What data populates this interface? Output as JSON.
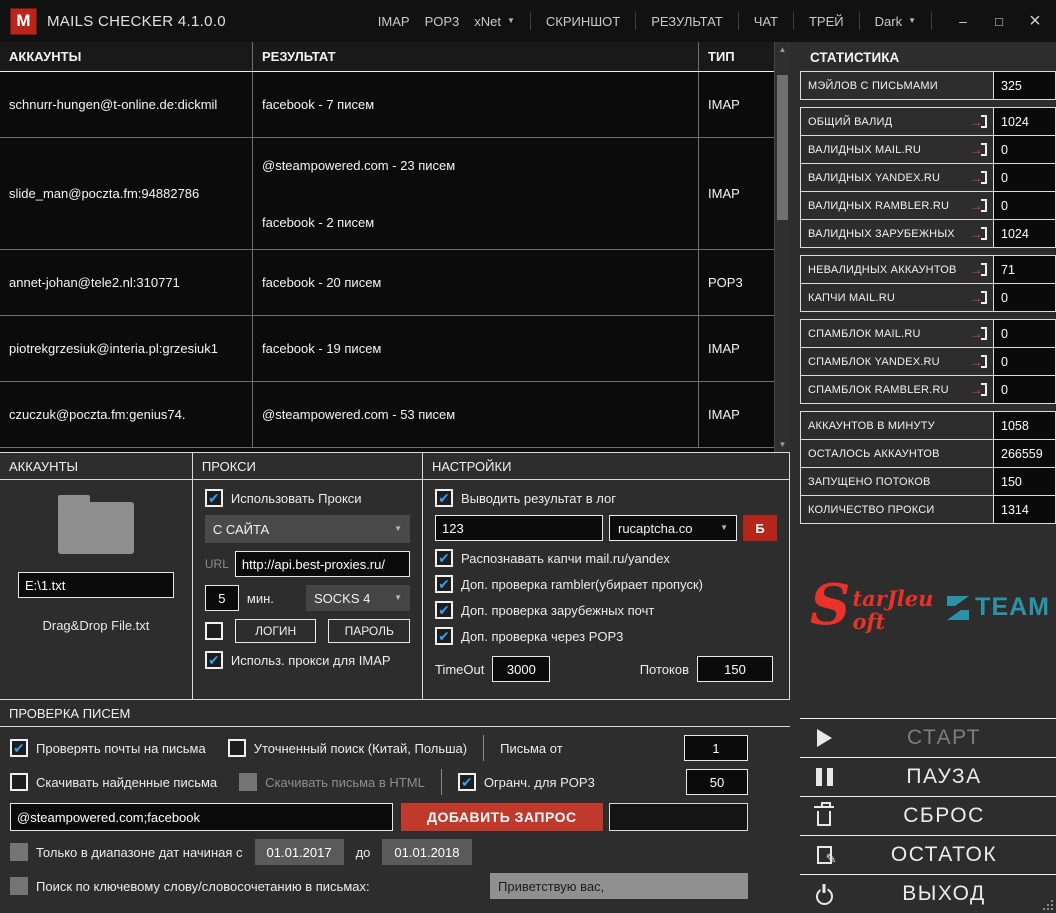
{
  "icons": {
    "check": "✔",
    "caret_down": "▼",
    "scroll_up": "▲",
    "scroll_down": "▼",
    "minimize": "–",
    "maximize": "□",
    "close": "×"
  },
  "colors": {
    "accent_red": "#b8251b",
    "button_red": "#c0392b",
    "check_blue": "#2f9ff2",
    "team_teal": "#2a93a8",
    "starjleu_red": "#e8322a"
  },
  "titlebar": {
    "logo_letter": "M",
    "title": "MAILS CHECKER 4.1.0.0",
    "menu": {
      "imap": "IMAP",
      "pop3": "POP3",
      "xnet": "xNet",
      "screenshot": "СКРИНШОТ",
      "result": "РЕЗУЛЬТАТ",
      "chat": "ЧАТ",
      "tray": "ТРЕЙ",
      "theme": "Dark"
    }
  },
  "results_table": {
    "headers": {
      "accounts": "АККАУНТЫ",
      "result": "РЕЗУЛЬТАТ",
      "type": "ТИП"
    },
    "rows": [
      {
        "account": "schnurr-hungen@t-online.de:dickmil",
        "line1": "facebook - 7 писем",
        "type": "IMAP"
      },
      {
        "account": "slide_man@poczta.fm:94882786",
        "line1": "@steampowered.com - 23 писем",
        "line2": "facebook - 2 писем",
        "type": "IMAP"
      },
      {
        "account": "annet-johan@tele2.nl:310771",
        "line1": "facebook - 20 писем",
        "type": "POP3"
      },
      {
        "account": "piotrekgrzesiuk@interia.pl:grzesiuk1",
        "line1": "facebook - 19 писем",
        "type": "IMAP"
      },
      {
        "account": "czuczuk@poczta.fm:genius74.",
        "line1": "@steampowered.com - 53 писем",
        "type": "IMAP"
      }
    ]
  },
  "stats": {
    "title": "СТАТИСТИКА",
    "rows": [
      {
        "label": "МЭЙЛОВ С ПИСЬМАМИ",
        "value": "325"
      },
      {
        "label": "ОБЩИЙ ВАЛИД",
        "value": "1024"
      },
      {
        "label": "ВАЛИДНЫХ MAIL.RU",
        "value": "0"
      },
      {
        "label": "ВАЛИДНЫХ YANDEX.RU",
        "value": "0"
      },
      {
        "label": "ВАЛИДНЫХ RAMBLER.RU",
        "value": "0"
      },
      {
        "label": "ВАЛИДНЫХ ЗАРУБЕЖНЫХ",
        "value": "1024"
      },
      {
        "label": "НЕВАЛИДНЫХ АККАУНТОВ",
        "value": "71"
      },
      {
        "label": "КАПЧИ MAIL.RU",
        "value": "0"
      },
      {
        "label": "СПАМБЛОК MAIL.RU",
        "value": "0"
      },
      {
        "label": "СПАМБЛОК YANDEX.RU",
        "value": "0"
      },
      {
        "label": "СПАМБЛОК RAMBLER.RU",
        "value": "0"
      },
      {
        "label": "АККАУНТОВ В МИНУТУ",
        "value": "1058"
      },
      {
        "label": "ОСТАЛОСЬ АККАУНТОВ",
        "value": "266559"
      },
      {
        "label": "ЗАПУЩЕНО ПОТОКОВ",
        "value": "150"
      },
      {
        "label": "КОЛИЧЕСТВО ПРОКСИ",
        "value": "1314"
      }
    ]
  },
  "accounts_panel": {
    "title": "АККАУНТЫ",
    "file_path": "E:\\1.txt",
    "hint": "Drag&Drop File.txt"
  },
  "proxy_panel": {
    "title": "ПРОКСИ",
    "use_proxy_label": "Использовать Прокси",
    "source_selected": "С САЙТА",
    "url_label": "URL",
    "url_value": "http://api.best-proxies.ru/",
    "interval_value": "5",
    "interval_unit": "мин.",
    "socks_selected": "SOCKS 4",
    "login_label": "ЛОГИН",
    "password_label": "ПАРОЛЬ",
    "imap_proxy_label": "Использ. прокси для IMAP"
  },
  "settings_panel": {
    "title": "НАСТРОЙКИ",
    "log_label": "Выводить результат в лог",
    "captcha_key_value": "123",
    "captcha_service_selected": "rucaptcha.co",
    "balance_button_label": "Б",
    "recognize_captcha_label": "Распознавать капчи mail.ru/yandex",
    "rambler_check_label": "Доп. проверка rambler(убирает пропуск)",
    "foreign_check_label": "Доп. проверка зарубежных почт",
    "pop3_check_label": "Доп. проверка через POP3",
    "timeout_label": "TimeOut",
    "timeout_value": "3000",
    "threads_label": "Потоков",
    "threads_value": "150"
  },
  "mail_check": {
    "title": "ПРОВЕРКА ПИСЕМ",
    "check_mails_label": "Проверять почты на письма",
    "refined_search_label": "Уточненный поиск (Китай, Польша)",
    "letters_from_label": "Письма от",
    "letters_from_value": "1",
    "download_letters_label": "Скачивать найденные письма",
    "download_html_label": "Скачивать письма в HTML",
    "pop3_limit_label": "Огранч. для POP3",
    "pop3_limit_value": "50",
    "query_value": "@steampowered.com;facebook",
    "add_query_label": "ДОБАВИТЬ ЗАПРОС",
    "date_range_label": "Только в диапазоне дат начиная с",
    "date_from": "01.01.2017",
    "date_to_word": "до",
    "date_to": "01.01.2018",
    "keyword_label": "Поиск по ключевому слову/словосочетанию в письмах:",
    "keyword_value": "Приветствую вас,"
  },
  "logos": {
    "sj_s": "S",
    "sj_top": "tarJleu",
    "sj_bottom": "oft",
    "team": "TEAM"
  },
  "actions": {
    "start": "СТАРТ",
    "pause": "ПАУЗА",
    "reset": "СБРОС",
    "remainder": "ОСТАТОК",
    "exit": "ВЫХОД"
  }
}
